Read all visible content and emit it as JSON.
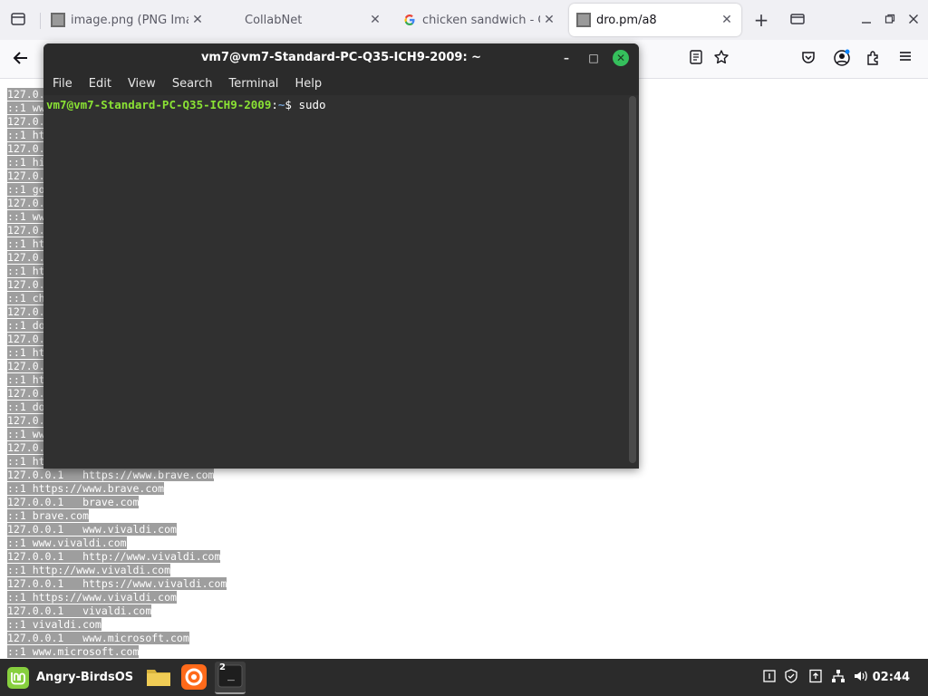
{
  "browser": {
    "tabs": [
      {
        "title": "image.png (PNG Image",
        "favicon": "image-icon"
      },
      {
        "title": "CollabNet",
        "favicon": ""
      },
      {
        "title": "chicken sandwich - Go",
        "favicon": "google-icon"
      },
      {
        "title": "dro.pm/a8",
        "favicon": "image-icon",
        "active": true
      }
    ],
    "new_tab_symbol": "+",
    "tab_close_symbol": "✕"
  },
  "hosts_lines": [
    "127.0.0.1   https://www.brave.com",
    "::1 https://www.brave.com",
    "127.0.0.1   brave.com",
    "::1 brave.com",
    "127.0.0.1   www.vivaldi.com",
    "::1 www.vivaldi.com",
    "127.0.0.1   http://www.vivaldi.com",
    "::1 http://www.vivaldi.com",
    "127.0.0.1   https://www.vivaldi.com",
    "::1 https://www.vivaldi.com",
    "127.0.0.1   vivaldi.com",
    "::1 vivaldi.com",
    "127.0.0.1   www.microsoft.com",
    "::1 www.microsoft.com"
  ],
  "hidden_line_fragments": [
    "127.0.",
    "::1 ww",
    "127.0.",
    "::1 ht",
    "127.0.",
    "::1 hi",
    "127.0.",
    "::1 go",
    "127.0.",
    "::1 ww",
    "127.0.",
    "::1 ht",
    "127.0.",
    "::1 ht",
    "127.0.",
    "::1 ch",
    "127.0.",
    "::1 do",
    "127.0.",
    "::1 ht",
    "127.0.",
    "::1 ht",
    "127.0.",
    "::1 do",
    "127.0.",
    "::1 ww",
    "127.0.",
    "::1 ht"
  ],
  "terminal": {
    "title": "vm7@vm7-Standard-PC-Q35-ICH9-2009: ~",
    "menu": [
      "File",
      "Edit",
      "View",
      "Search",
      "Terminal",
      "Help"
    ],
    "prompt_user": "vm7@vm7-Standard-PC-Q35-ICH9-2009",
    "prompt_sep": ":",
    "prompt_path": "~",
    "prompt_symbol": "$ ",
    "command": "sudo",
    "minimize_symbol": "–",
    "maximize_symbol": "□",
    "close_symbol": "✕"
  },
  "taskbar": {
    "start_label": "Angry-BirdsOS",
    "terminal_badge": "2",
    "terminal_glyph": "_",
    "clock": "02:44"
  },
  "colors": {
    "prompt_user": "#8ae234",
    "prompt_path": "#729fcf",
    "close_button": "#35bf5c",
    "text_highlight": "#9e9e9e"
  }
}
